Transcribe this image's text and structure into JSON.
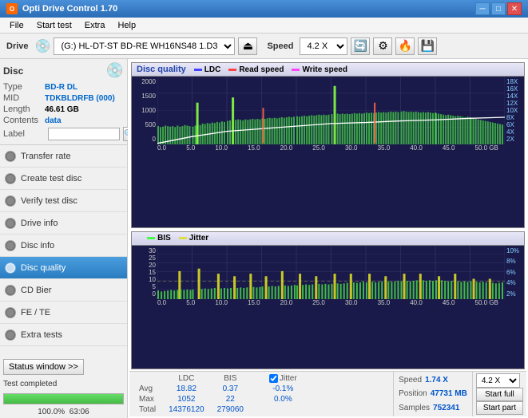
{
  "titleBar": {
    "title": "Opti Drive Control 1.70",
    "iconLabel": "O",
    "minBtn": "─",
    "maxBtn": "□",
    "closeBtn": "✕"
  },
  "menuBar": {
    "items": [
      "File",
      "Start test",
      "Extra",
      "Help"
    ]
  },
  "toolbar": {
    "driveLabel": "Drive",
    "driveValue": "(G:)  HL-DT-ST BD-RE  WH16NS48 1.D3",
    "speedLabel": "Speed",
    "speedValue": "4.2 X"
  },
  "disc": {
    "sectionLabel": "Disc",
    "typeKey": "Type",
    "typeVal": "BD-R DL",
    "midKey": "MID",
    "midVal": "TDKBLDRFB (000)",
    "lengthKey": "Length",
    "lengthVal": "46.61 GB",
    "contentsKey": "Contents",
    "contentsVal": "data",
    "labelKey": "Label",
    "labelVal": ""
  },
  "navItems": [
    {
      "id": "transfer-rate",
      "label": "Transfer rate",
      "active": false
    },
    {
      "id": "create-test-disc",
      "label": "Create test disc",
      "active": false
    },
    {
      "id": "verify-test-disc",
      "label": "Verify test disc",
      "active": false
    },
    {
      "id": "drive-info",
      "label": "Drive info",
      "active": false
    },
    {
      "id": "disc-info",
      "label": "Disc info",
      "active": false
    },
    {
      "id": "disc-quality",
      "label": "Disc quality",
      "active": true
    },
    {
      "id": "cd-bier",
      "label": "CD Bier",
      "active": false
    },
    {
      "id": "fe-te",
      "label": "FE / TE",
      "active": false
    },
    {
      "id": "extra-tests",
      "label": "Extra tests",
      "active": false
    }
  ],
  "statusBtn": "Status window >>",
  "statusText": "Test completed",
  "progressPct": "100.0%",
  "progressNum": "63:06",
  "chart1": {
    "title": "Disc quality",
    "legend": [
      {
        "label": "LDC",
        "color": "#4444ff"
      },
      {
        "label": "Read speed",
        "color": "#ff4444"
      },
      {
        "label": "Write speed",
        "color": "#ff44ff"
      }
    ],
    "yAxisLeft": [
      "2000",
      "1500",
      "1000",
      "500",
      "0"
    ],
    "yAxisRight": [
      "18X",
      "16X",
      "14X",
      "12X",
      "10X",
      "8X",
      "6X",
      "4X",
      "2X"
    ],
    "xAxisLabels": [
      "0.0",
      "5.0",
      "10.0",
      "15.0",
      "20.0",
      "25.0",
      "30.0",
      "35.0",
      "40.0",
      "45.0",
      "50.0 GB"
    ]
  },
  "chart2": {
    "title": "",
    "legend": [
      {
        "label": "BIS",
        "color": "#44ff44"
      },
      {
        "label": "Jitter",
        "color": "#dddd44"
      }
    ],
    "yAxisLeft": [
      "30",
      "25",
      "20",
      "15",
      "10",
      "5",
      "0"
    ],
    "yAxisRight": [
      "10%",
      "8%",
      "6%",
      "4%",
      "2%"
    ],
    "xAxisLabels": [
      "0.0",
      "5.0",
      "10.0",
      "15.0",
      "20.0",
      "25.0",
      "30.0",
      "35.0",
      "40.0",
      "45.0",
      "50.0 GB"
    ]
  },
  "stats": {
    "headers": [
      "",
      "LDC",
      "BIS",
      "",
      "Jitter",
      "Speed",
      "",
      ""
    ],
    "avg": {
      "label": "Avg",
      "ldc": "18.82",
      "bis": "0.37",
      "jitter": "-0.1%",
      "speed": "1.74 X"
    },
    "max": {
      "label": "Max",
      "ldc": "1052",
      "bis": "22",
      "jitter": "0.0%"
    },
    "total": {
      "label": "Total",
      "ldc": "14376120",
      "bis": "279060"
    },
    "position": {
      "label": "Position",
      "val": "47731 MB"
    },
    "samples": {
      "label": "Samples",
      "val": "752341"
    },
    "speedSelectVal": "4.2 X",
    "startFullBtn": "Start full",
    "startPartBtn": "Start part",
    "jitterLabel": "Jitter",
    "jitterChecked": true
  }
}
